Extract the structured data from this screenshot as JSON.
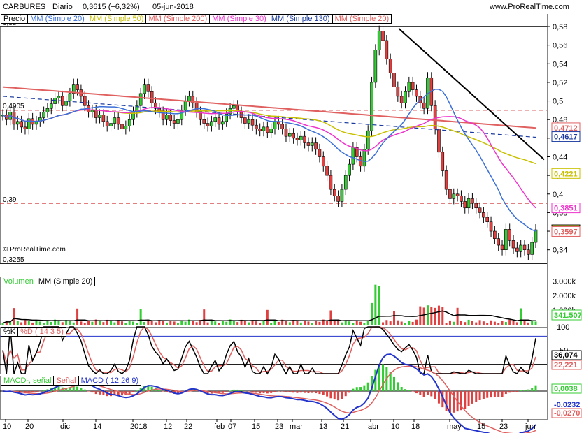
{
  "header": {
    "symbol": "CARBURES",
    "period": "Diario",
    "quote": "0,3615 (+6,32%)",
    "date": "05-jun-2018",
    "site": "www.ProRealTime.com"
  },
  "copyright": "© ProRealTime.com",
  "colors": {
    "up": "#33cc33",
    "down": "#e04040",
    "ma20": "#3a6fd8",
    "ma50": "#c8c000",
    "ma200": "#e06060",
    "ma30": "#ee33cc",
    "ma130": "#1a3aa0",
    "macd": "#2233cc",
    "signal": "#e06060",
    "volma": "#000000"
  },
  "legends": {
    "price": [
      "Precio",
      "MM (Simple 20)",
      "MM (Simple 50)",
      "MM (Simple 200)",
      "MM (Simple 30)",
      "MM (Simple 130)",
      "MM (Simple 20)"
    ],
    "volume": [
      "Volumen",
      "MM (Simple 20)"
    ],
    "stoch": [
      "%K",
      "%D ( 14 3 5)"
    ],
    "macd": [
      "MACD-, señal",
      "Señal",
      "MACD ( 12 26 9)"
    ]
  },
  "chart_data": [
    {
      "type": "candlestick",
      "title": "CARBURES",
      "ylim": [
        0.3255,
        0.58
      ],
      "yticks": [
        "0,58",
        "0,56",
        "0,54",
        "0,52",
        "0,5",
        "0,48",
        "0,46",
        "0,44",
        "0,42",
        "0,4",
        "0,38",
        "0,36",
        "0,34"
      ],
      "left_levels": [
        "0,58",
        "0,4905",
        "0,39",
        "0,3255"
      ],
      "hlines_dashed": [
        0.49,
        0.39
      ],
      "trendline": [
        [
          0.578,
          0.437
        ]
      ],
      "value_tags": [
        {
          "label": "0,4712",
          "value": 0.4712,
          "color": "#e06060"
        },
        {
          "label": "0,4617",
          "value": 0.4617,
          "color": "#1a3aa0"
        },
        {
          "label": "0,4221",
          "value": 0.4221,
          "color": "#c8c000"
        },
        {
          "label": "0,3851",
          "value": 0.3851,
          "color": "#ee33cc"
        },
        {
          "label": "0,3615",
          "value": 0.3615,
          "color": "#000000"
        },
        {
          "label": "0,3597",
          "value": 0.3597,
          "color": "#e06060"
        }
      ],
      "x_labels": [
        "10",
        "20",
        "dic",
        "14",
        "2018",
        "12",
        "22",
        "feb",
        "07",
        "15",
        "23",
        "mar",
        "13",
        "21",
        "abr",
        "10",
        "18",
        "may",
        "15",
        "23",
        "jun"
      ],
      "close": [
        0.485,
        0.48,
        0.488,
        0.475,
        0.478,
        0.472,
        0.47,
        0.481,
        0.475,
        0.478,
        0.482,
        0.488,
        0.492,
        0.497,
        0.503,
        0.505,
        0.495,
        0.5,
        0.508,
        0.518,
        0.512,
        0.505,
        0.495,
        0.488,
        0.49,
        0.482,
        0.485,
        0.478,
        0.473,
        0.476,
        0.482,
        0.475,
        0.47,
        0.473,
        0.48,
        0.488,
        0.495,
        0.508,
        0.518,
        0.51,
        0.498,
        0.492,
        0.488,
        0.48,
        0.485,
        0.479,
        0.476,
        0.48,
        0.49,
        0.5,
        0.505,
        0.498,
        0.488,
        0.48,
        0.476,
        0.473,
        0.478,
        0.482,
        0.475,
        0.478,
        0.486,
        0.492,
        0.495,
        0.488,
        0.482,
        0.476,
        0.48,
        0.474,
        0.47,
        0.468,
        0.472,
        0.466,
        0.47,
        0.478,
        0.475,
        0.47,
        0.462,
        0.465,
        0.46,
        0.458,
        0.462,
        0.455,
        0.452,
        0.455,
        0.448,
        0.44,
        0.43,
        0.42,
        0.405,
        0.398,
        0.392,
        0.405,
        0.42,
        0.432,
        0.45,
        0.44,
        0.43,
        0.448,
        0.468,
        0.52,
        0.555,
        0.575,
        0.565,
        0.545,
        0.53,
        0.515,
        0.505,
        0.498,
        0.51,
        0.52,
        0.512,
        0.505,
        0.498,
        0.492,
        0.525,
        0.495,
        0.47,
        0.445,
        0.425,
        0.405,
        0.395,
        0.4,
        0.398,
        0.392,
        0.385,
        0.395,
        0.39,
        0.385,
        0.38,
        0.375,
        0.37,
        0.36,
        0.352,
        0.345,
        0.34,
        0.362,
        0.35,
        0.342,
        0.338,
        0.345,
        0.34,
        0.335,
        0.348,
        0.3615
      ]
    },
    {
      "type": "bar",
      "title": "Volumen",
      "yticks": [
        "3.000k",
        "2.000k",
        "1.000k"
      ],
      "ylim": [
        0,
        3300000
      ],
      "last_label": "341.507"
    },
    {
      "type": "line",
      "title": "%K",
      "ylim": [
        0,
        100
      ],
      "yticks": [
        "100",
        "50"
      ],
      "labels": [
        "36,074",
        "22,221"
      ]
    },
    {
      "type": "line",
      "title": "MACD",
      "labels": [
        "0,0038",
        "-0,0232",
        "-0,0270"
      ]
    }
  ]
}
